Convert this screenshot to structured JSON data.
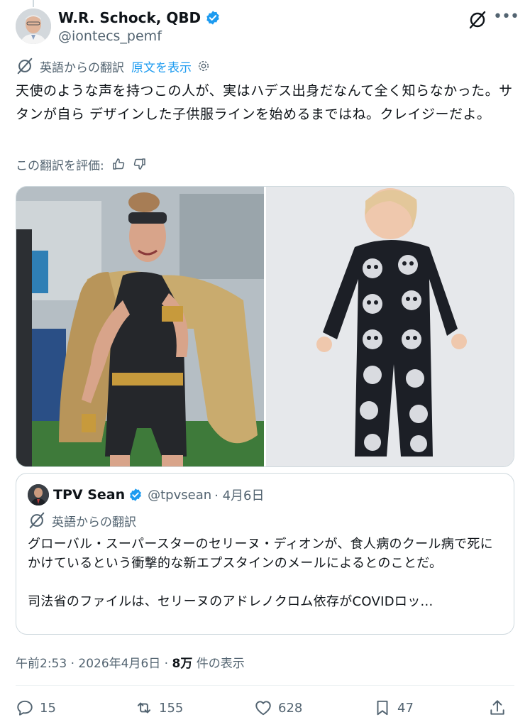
{
  "author": {
    "name": "W.R. Schock, QBD",
    "handle": "@iontecs_pemf"
  },
  "translation": {
    "label": "英語からの翻訳",
    "show_original": "原文を表示",
    "rate_label": "この翻訳を評価:"
  },
  "post": {
    "text": "天使のような声を持つこの人が、実はハデス出身だなんて全く知らなかった。サタンが自ら デザインした子供服ラインを始めるまではね。クレイジーだよ。"
  },
  "quote": {
    "name": "TPV Sean",
    "handle": "@tpvsean",
    "date": "· 4月6日",
    "translation_label": "英語からの翻訳",
    "paragraph1": "グローバル・スーパースターのセリーヌ・ディオンが、食人病のクール病で死にかけているという衝撃的な新エプスタインのメールによるとのことだ。",
    "paragraph2": "司法省のファイルは、セリーヌのアドレノクロム依存がCOVIDロッ..."
  },
  "meta": {
    "time": "午前2:53 · 2026年4月6日 · ",
    "views_count": "8万",
    "views_label": " 件の表示"
  },
  "actions": {
    "replies": "15",
    "reposts": "155",
    "likes": "628",
    "bookmarks": "47"
  },
  "colors": {
    "accent": "#1d9bf0",
    "secondary_text": "#536471",
    "border": "#cfd9de"
  }
}
